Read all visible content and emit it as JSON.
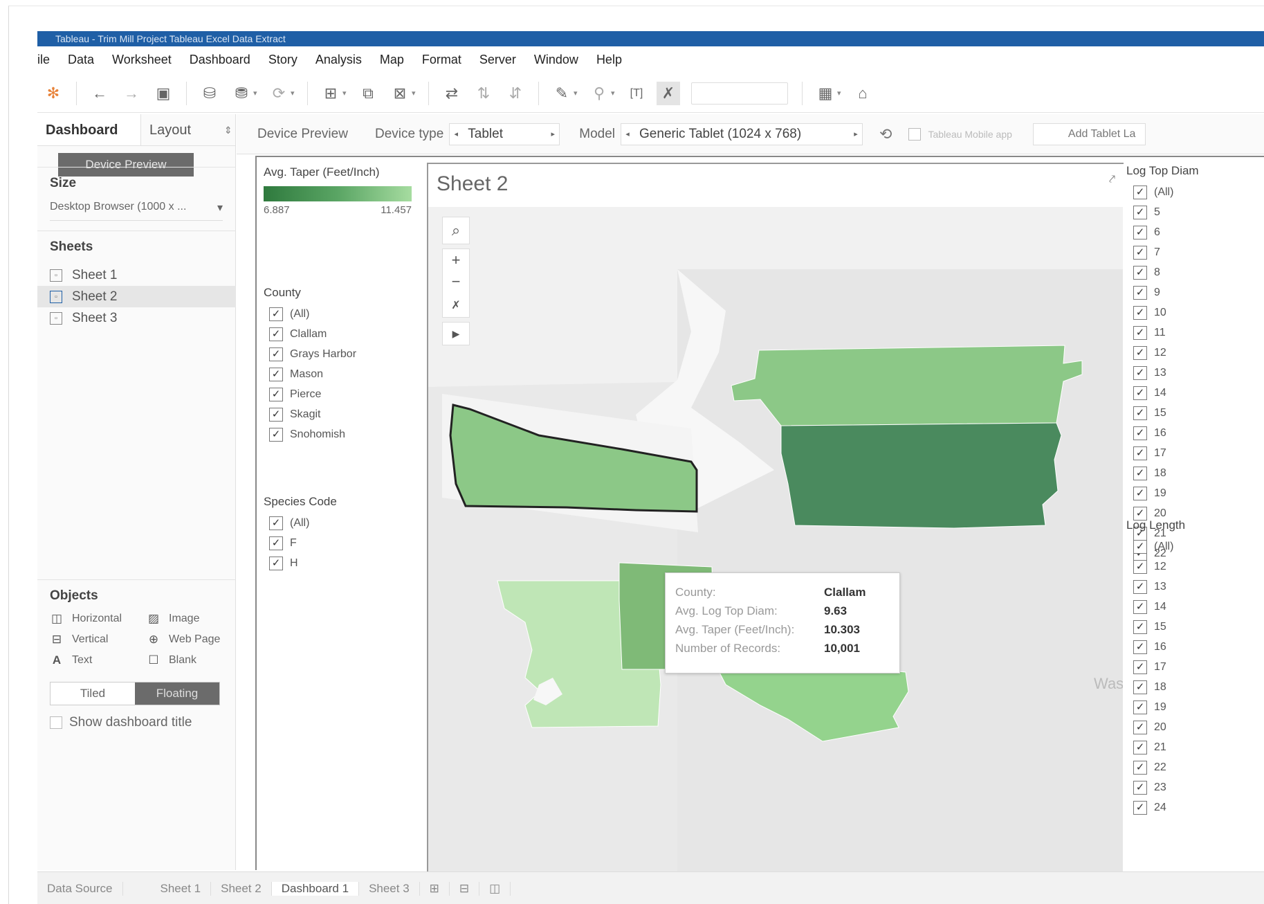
{
  "window": {
    "title": "Tableau - Trim Mill Project Tableau Excel Data Extract"
  },
  "menu": [
    "ile",
    "Data",
    "Worksheet",
    "Dashboard",
    "Story",
    "Analysis",
    "Map",
    "Format",
    "Server",
    "Window",
    "Help"
  ],
  "left_panel": {
    "tab_dashboard": "Dashboard",
    "tab_layout": "Layout",
    "device_preview_button": "Device Preview",
    "size_heading": "Size",
    "size_value": "Desktop Browser (1000 x ...",
    "sheets_heading": "Sheets",
    "sheets": [
      "Sheet 1",
      "Sheet 2",
      "Sheet 3"
    ],
    "objects_heading": "Objects",
    "objects": [
      "Horizontal",
      "Image",
      "Vertical",
      "Web Page",
      "Text",
      "Blank"
    ],
    "tiled": "Tiled",
    "floating": "Floating",
    "show_title": "Show dashboard title"
  },
  "device_bar": {
    "device_preview": "Device Preview",
    "device_type_label": "Device type",
    "device_type_value": "Tablet",
    "model_label": "Model",
    "model_value": "Generic Tablet (1024 x 768)",
    "mobile_app": "Tableau Mobile app",
    "add_layout": "Add Tablet La"
  },
  "legend": {
    "title": "Avg. Taper (Feet/Inch)",
    "min": "6.887",
    "max": "11.457"
  },
  "county_filter": {
    "title": "County",
    "items": [
      "(All)",
      "Clallam",
      "Grays Harbor",
      "Mason",
      "Pierce",
      "Skagit",
      "Snohomish"
    ]
  },
  "species_filter": {
    "title": "Species Code",
    "items": [
      "(All)",
      "F",
      "H"
    ]
  },
  "sheet2": {
    "title": "Sheet 2",
    "map_label": "Wash",
    "tooltip": [
      {
        "key": "County:",
        "value": "Clallam"
      },
      {
        "key": "Avg. Log Top Diam:",
        "value": "9.63"
      },
      {
        "key": "Avg. Taper (Feet/Inch):",
        "value": "10.303"
      },
      {
        "key": "Number of Records:",
        "value": "10,001"
      }
    ]
  },
  "log_top_diam": {
    "title": "Log Top Diam",
    "items": [
      "(All)",
      "5",
      "6",
      "7",
      "8",
      "9",
      "10",
      "11",
      "12",
      "13",
      "14",
      "15",
      "16",
      "17",
      "18",
      "19",
      "20",
      "21",
      "22"
    ]
  },
  "log_length": {
    "title": "Log Length",
    "items": [
      "(All)",
      "12",
      "13",
      "14",
      "15",
      "16",
      "17",
      "18",
      "19",
      "20",
      "21",
      "22",
      "23",
      "24"
    ]
  },
  "bottom_tabs": [
    "Data Source",
    "Sheet 1",
    "Sheet 2",
    "Dashboard 1",
    "Sheet 3"
  ],
  "colors": {
    "accent": "#1f5fa6",
    "map_dark": "#4a8a5e",
    "map_mid": "#7fc47a",
    "map_light": "#b8e2b0"
  }
}
